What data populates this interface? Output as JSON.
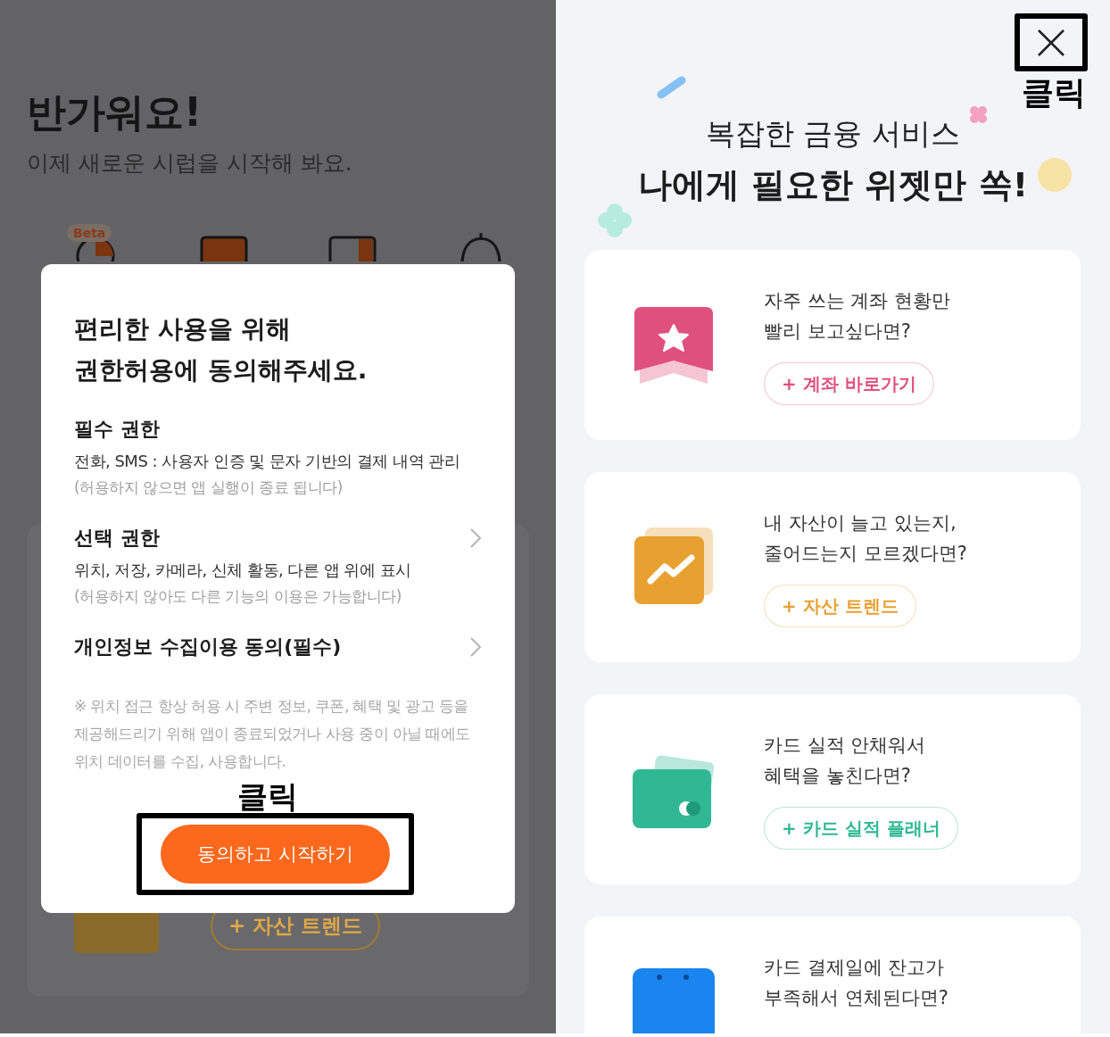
{
  "left_screen": {
    "greeting": {
      "title": "반가워요!",
      "subtitle": "이제 새로운 시럽을 시작해 봐요."
    },
    "beta_badge": "Beta",
    "background_card": {
      "button": "+ 자산 트렌드"
    },
    "permission_dialog": {
      "title_lines": [
        "편리한 사용을 위해",
        "권한허용에 동의해주세요."
      ],
      "sections": [
        {
          "kind": "plain",
          "heading": "필수 권한",
          "description": "전화, SMS : 사용자 인증 및 문자 기반의 결제 내역 관리",
          "note": "(허용하지 않으면 앱 실행이 종료 됩니다)"
        },
        {
          "kind": "link",
          "heading": "선택 권한",
          "description": "위치, 저장, 카메라, 신체 활동, 다른 앱 위에 표시",
          "note": "(허용하지 않아도 다른 기능의 이용은 가능합니다)"
        },
        {
          "kind": "link",
          "heading": "개인정보 수집이용 동의(필수)"
        }
      ],
      "notice": "※ 위치 접근 항상 허용 시 주변 정보, 쿠폰, 혜택 및 광고 등을 제공해드리기 위해 앱이 종료되었거나 사용 중이 아닐 때에도 위치 데이터를 수집, 사용합니다.",
      "confirm_button": "동의하고 시작하기"
    },
    "click_label": "클릭"
  },
  "right_screen": {
    "click_label": "클릭",
    "headline": {
      "subtitle": "복잡한 금융 서비스",
      "title": "나에게 필요한 위젯만 쏙!"
    },
    "widgets": [
      {
        "kind": "account",
        "color": "#e0507e",
        "question_lines": [
          "자주 쓰는 계좌 현황만",
          "빨리 보고싶다면?"
        ],
        "button": "+ 계좌 바로가기"
      },
      {
        "kind": "trend",
        "color": "#e8a030",
        "question_lines": [
          "내 자산이 늘고 있는지,",
          "줄어드는지 모르겠다면?"
        ],
        "button": "+ 자산 트렌드"
      },
      {
        "kind": "card",
        "color": "#2fb893",
        "question_lines": [
          "카드 실적 안채워서",
          "혜택을 놓친다면?"
        ],
        "button": "+ 카드 실적 플래너"
      },
      {
        "kind": "calendar",
        "color": "#1a84f0",
        "question_lines": [
          "카드 결제일에 잔고가",
          "부족해서 연체된다면?"
        ]
      }
    ]
  }
}
